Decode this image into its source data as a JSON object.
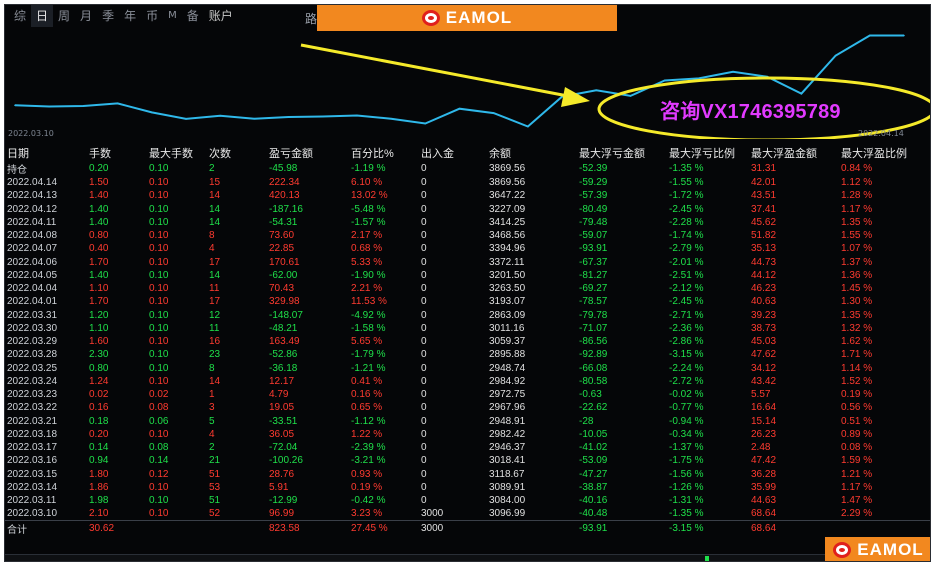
{
  "tabs": [
    {
      "label": "综",
      "active": false,
      "small": false
    },
    {
      "label": "日",
      "active": true,
      "small": false
    },
    {
      "label": "周",
      "active": false,
      "small": false
    },
    {
      "label": "月",
      "active": false,
      "small": false
    },
    {
      "label": "季",
      "active": false,
      "small": false
    },
    {
      "label": "年",
      "active": false,
      "small": false
    },
    {
      "label": "币",
      "active": false,
      "small": false
    },
    {
      "label": "M",
      "active": false,
      "small": true
    },
    {
      "label": "备",
      "active": false,
      "small": false
    },
    {
      "label": "账户",
      "active": false,
      "small": false
    }
  ],
  "extra_label": "路",
  "watermark": {
    "brand": "EAMOL"
  },
  "annotation": {
    "text": "咨询VX1746395789",
    "arrow_color": "#f5ea2a",
    "ellipse_color": "#f5ea2a"
  },
  "chart_data": {
    "type": "line",
    "x_start_label": "2022.03.10",
    "x_end_label": "2022.04.14",
    "line_color": "#2fb8ea",
    "x": [
      "2022.03.10",
      "2022.03.11",
      "2022.03.14",
      "2022.03.15",
      "2022.03.16",
      "2022.03.17",
      "2022.03.18",
      "2022.03.21",
      "2022.03.22",
      "2022.03.23",
      "2022.03.24",
      "2022.03.25",
      "2022.03.28",
      "2022.03.29",
      "2022.03.30",
      "2022.03.31",
      "2022.04.01",
      "2022.04.04",
      "2022.04.05",
      "2022.04.06",
      "2022.04.07",
      "2022.04.08",
      "2022.04.11",
      "2022.04.12",
      "2022.04.13",
      "2022.04.14",
      "2022.04.14"
    ],
    "values": [
      3096.99,
      3084.0,
      3089.91,
      3118.67,
      3018.41,
      2946.37,
      2982.42,
      2948.91,
      2967.96,
      2972.75,
      2984.92,
      2948.74,
      2895.88,
      3059.37,
      3011.16,
      2863.09,
      3193.07,
      3263.5,
      3201.5,
      3372.11,
      3394.96,
      3468.56,
      3414.25,
      3227.09,
      3647.22,
      3869.56,
      3869.56
    ]
  },
  "columns": [
    "日期",
    "手数",
    "最大手数",
    "次数",
    "盈亏金额",
    "百分比%",
    "出入金",
    "余额",
    "最大浮亏金额",
    "最大浮亏比例",
    "最大浮盈金额",
    "最大浮盈比例"
  ],
  "holding": {
    "date": "持仓",
    "lots": "0.20",
    "max_lots": "0.10",
    "count": "2",
    "pnl": "-45.98",
    "pct": "-1.19 %",
    "deposit": "0",
    "balance": "3869.56",
    "max_float_loss": "-52.39",
    "max_float_loss_pct": "-1.35 %",
    "max_float_profit": "31.31",
    "max_float_profit_pct": "0.84 %"
  },
  "rows": [
    {
      "date": "2022.04.14",
      "lots": "1.50",
      "max_lots": "0.10",
      "count": "15",
      "pnl": "222.34",
      "pct": "6.10 %",
      "deposit": "0",
      "balance": "3869.56",
      "max_float_loss": "-59.29",
      "max_float_loss_pct": "-1.55 %",
      "max_float_profit": "42.01",
      "max_float_profit_pct": "1.12 %"
    },
    {
      "date": "2022.04.13",
      "lots": "1.40",
      "max_lots": "0.10",
      "count": "14",
      "pnl": "420.13",
      "pct": "13.02 %",
      "deposit": "0",
      "balance": "3647.22",
      "max_float_loss": "-57.39",
      "max_float_loss_pct": "-1.72 %",
      "max_float_profit": "43.51",
      "max_float_profit_pct": "1.28 %"
    },
    {
      "date": "2022.04.12",
      "lots": "1.40",
      "max_lots": "0.10",
      "count": "14",
      "pnl": "-187.16",
      "pct": "-5.48 %",
      "deposit": "0",
      "balance": "3227.09",
      "max_float_loss": "-80.49",
      "max_float_loss_pct": "-2.45 %",
      "max_float_profit": "37.41",
      "max_float_profit_pct": "1.17 %"
    },
    {
      "date": "2022.04.11",
      "lots": "1.40",
      "max_lots": "0.10",
      "count": "14",
      "pnl": "-54.31",
      "pct": "-1.57 %",
      "deposit": "0",
      "balance": "3414.25",
      "max_float_loss": "-79.48",
      "max_float_loss_pct": "-2.28 %",
      "max_float_profit": "45.62",
      "max_float_profit_pct": "1.35 %"
    },
    {
      "date": "2022.04.08",
      "lots": "0.80",
      "max_lots": "0.10",
      "count": "8",
      "pnl": "73.60",
      "pct": "2.17 %",
      "deposit": "0",
      "balance": "3468.56",
      "max_float_loss": "-59.07",
      "max_float_loss_pct": "-1.74 %",
      "max_float_profit": "51.82",
      "max_float_profit_pct": "1.55 %"
    },
    {
      "date": "2022.04.07",
      "lots": "0.40",
      "max_lots": "0.10",
      "count": "4",
      "pnl": "22.85",
      "pct": "0.68 %",
      "deposit": "0",
      "balance": "3394.96",
      "max_float_loss": "-93.91",
      "max_float_loss_pct": "-2.79 %",
      "max_float_profit": "35.13",
      "max_float_profit_pct": "1.07 %"
    },
    {
      "date": "2022.04.06",
      "lots": "1.70",
      "max_lots": "0.10",
      "count": "17",
      "pnl": "170.61",
      "pct": "5.33 %",
      "deposit": "0",
      "balance": "3372.11",
      "max_float_loss": "-67.37",
      "max_float_loss_pct": "-2.01 %",
      "max_float_profit": "44.73",
      "max_float_profit_pct": "1.37 %"
    },
    {
      "date": "2022.04.05",
      "lots": "1.40",
      "max_lots": "0.10",
      "count": "14",
      "pnl": "-62.00",
      "pct": "-1.90 %",
      "deposit": "0",
      "balance": "3201.50",
      "max_float_loss": "-81.27",
      "max_float_loss_pct": "-2.51 %",
      "max_float_profit": "44.12",
      "max_float_profit_pct": "1.36 %"
    },
    {
      "date": "2022.04.04",
      "lots": "1.10",
      "max_lots": "0.10",
      "count": "11",
      "pnl": "70.43",
      "pct": "2.21 %",
      "deposit": "0",
      "balance": "3263.50",
      "max_float_loss": "-69.27",
      "max_float_loss_pct": "-2.12 %",
      "max_float_profit": "46.23",
      "max_float_profit_pct": "1.45 %"
    },
    {
      "date": "2022.04.01",
      "lots": "1.70",
      "max_lots": "0.10",
      "count": "17",
      "pnl": "329.98",
      "pct": "11.53 %",
      "deposit": "0",
      "balance": "3193.07",
      "max_float_loss": "-78.57",
      "max_float_loss_pct": "-2.45 %",
      "max_float_profit": "40.63",
      "max_float_profit_pct": "1.30 %"
    },
    {
      "date": "2022.03.31",
      "lots": "1.20",
      "max_lots": "0.10",
      "count": "12",
      "pnl": "-148.07",
      "pct": "-4.92 %",
      "deposit": "0",
      "balance": "2863.09",
      "max_float_loss": "-79.78",
      "max_float_loss_pct": "-2.71 %",
      "max_float_profit": "39.23",
      "max_float_profit_pct": "1.35 %"
    },
    {
      "date": "2022.03.30",
      "lots": "1.10",
      "max_lots": "0.10",
      "count": "11",
      "pnl": "-48.21",
      "pct": "-1.58 %",
      "deposit": "0",
      "balance": "3011.16",
      "max_float_loss": "-71.07",
      "max_float_loss_pct": "-2.36 %",
      "max_float_profit": "38.73",
      "max_float_profit_pct": "1.32 %"
    },
    {
      "date": "2022.03.29",
      "lots": "1.60",
      "max_lots": "0.10",
      "count": "16",
      "pnl": "163.49",
      "pct": "5.65 %",
      "deposit": "0",
      "balance": "3059.37",
      "max_float_loss": "-86.56",
      "max_float_loss_pct": "-2.86 %",
      "max_float_profit": "45.03",
      "max_float_profit_pct": "1.62 %"
    },
    {
      "date": "2022.03.28",
      "lots": "2.30",
      "max_lots": "0.10",
      "count": "23",
      "pnl": "-52.86",
      "pct": "-1.79 %",
      "deposit": "0",
      "balance": "2895.88",
      "max_float_loss": "-92.89",
      "max_float_loss_pct": "-3.15 %",
      "max_float_profit": "47.62",
      "max_float_profit_pct": "1.71 %"
    },
    {
      "date": "2022.03.25",
      "lots": "0.80",
      "max_lots": "0.10",
      "count": "8",
      "pnl": "-36.18",
      "pct": "-1.21 %",
      "deposit": "0",
      "balance": "2948.74",
      "max_float_loss": "-66.08",
      "max_float_loss_pct": "-2.24 %",
      "max_float_profit": "34.12",
      "max_float_profit_pct": "1.14 %"
    },
    {
      "date": "2022.03.24",
      "lots": "1.24",
      "max_lots": "0.10",
      "count": "14",
      "pnl": "12.17",
      "pct": "0.41 %",
      "deposit": "0",
      "balance": "2984.92",
      "max_float_loss": "-80.58",
      "max_float_loss_pct": "-2.72 %",
      "max_float_profit": "43.42",
      "max_float_profit_pct": "1.52 %"
    },
    {
      "date": "2022.03.23",
      "lots": "0.02",
      "max_lots": "0.02",
      "count": "1",
      "pnl": "4.79",
      "pct": "0.16 %",
      "deposit": "0",
      "balance": "2972.75",
      "max_float_loss": "-0.63",
      "max_float_loss_pct": "-0.02 %",
      "max_float_profit": "5.57",
      "max_float_profit_pct": "0.19 %"
    },
    {
      "date": "2022.03.22",
      "lots": "0.16",
      "max_lots": "0.08",
      "count": "3",
      "pnl": "19.05",
      "pct": "0.65 %",
      "deposit": "0",
      "balance": "2967.96",
      "max_float_loss": "-22.62",
      "max_float_loss_pct": "-0.77 %",
      "max_float_profit": "16.64",
      "max_float_profit_pct": "0.56 %"
    },
    {
      "date": "2022.03.21",
      "lots": "0.18",
      "max_lots": "0.06",
      "count": "5",
      "pnl": "-33.51",
      "pct": "-1.12 %",
      "deposit": "0",
      "balance": "2948.91",
      "max_float_loss": "-28",
      "max_float_loss_pct": "-0.94 %",
      "max_float_profit": "15.14",
      "max_float_profit_pct": "0.51 %"
    },
    {
      "date": "2022.03.18",
      "lots": "0.20",
      "max_lots": "0.10",
      "count": "4",
      "pnl": "36.05",
      "pct": "1.22 %",
      "deposit": "0",
      "balance": "2982.42",
      "max_float_loss": "-10.05",
      "max_float_loss_pct": "-0.34 %",
      "max_float_profit": "26.23",
      "max_float_profit_pct": "0.89 %"
    },
    {
      "date": "2022.03.17",
      "lots": "0.14",
      "max_lots": "0.08",
      "count": "2",
      "pnl": "-72.04",
      "pct": "-2.39 %",
      "deposit": "0",
      "balance": "2946.37",
      "max_float_loss": "-41.02",
      "max_float_loss_pct": "-1.37 %",
      "max_float_profit": "2.48",
      "max_float_profit_pct": "0.08 %"
    },
    {
      "date": "2022.03.16",
      "lots": "0.94",
      "max_lots": "0.14",
      "count": "21",
      "pnl": "-100.26",
      "pct": "-3.21 %",
      "deposit": "0",
      "balance": "3018.41",
      "max_float_loss": "-53.09",
      "max_float_loss_pct": "-1.75 %",
      "max_float_profit": "47.42",
      "max_float_profit_pct": "1.59 %"
    },
    {
      "date": "2022.03.15",
      "lots": "1.80",
      "max_lots": "0.12",
      "count": "51",
      "pnl": "28.76",
      "pct": "0.93 %",
      "deposit": "0",
      "balance": "3118.67",
      "max_float_loss": "-47.27",
      "max_float_loss_pct": "-1.56 %",
      "max_float_profit": "36.28",
      "max_float_profit_pct": "1.21 %"
    },
    {
      "date": "2022.03.14",
      "lots": "1.86",
      "max_lots": "0.10",
      "count": "53",
      "pnl": "5.91",
      "pct": "0.19 %",
      "deposit": "0",
      "balance": "3089.91",
      "max_float_loss": "-38.87",
      "max_float_loss_pct": "-1.26 %",
      "max_float_profit": "35.99",
      "max_float_profit_pct": "1.17 %"
    },
    {
      "date": "2022.03.11",
      "lots": "1.98",
      "max_lots": "0.10",
      "count": "51",
      "pnl": "-12.99",
      "pct": "-0.42 %",
      "deposit": "0",
      "balance": "3084.00",
      "max_float_loss": "-40.16",
      "max_float_loss_pct": "-1.31 %",
      "max_float_profit": "44.63",
      "max_float_profit_pct": "1.47 %"
    },
    {
      "date": "2022.03.10",
      "lots": "2.10",
      "max_lots": "0.10",
      "count": "52",
      "pnl": "96.99",
      "pct": "3.23 %",
      "deposit": "3000",
      "balance": "3096.99",
      "max_float_loss": "-40.48",
      "max_float_loss_pct": "-1.35 %",
      "max_float_profit": "68.64",
      "max_float_profit_pct": "2.29 %"
    }
  ],
  "total": {
    "date": "合计",
    "lots": "30.62",
    "max_lots": "",
    "count": "",
    "pnl": "823.58",
    "pct": "27.45 %",
    "deposit": "3000",
    "balance": "",
    "max_float_loss": "-93.91",
    "max_float_loss_pct": "-3.15 %",
    "max_float_profit": "68.64",
    "max_float_profit_pct": ""
  },
  "colors": {
    "positive": "#ff3b30",
    "negative": "#1fe04a",
    "neutral": "#e0e0e0",
    "background": "#050608",
    "brand": "#f2881f"
  }
}
